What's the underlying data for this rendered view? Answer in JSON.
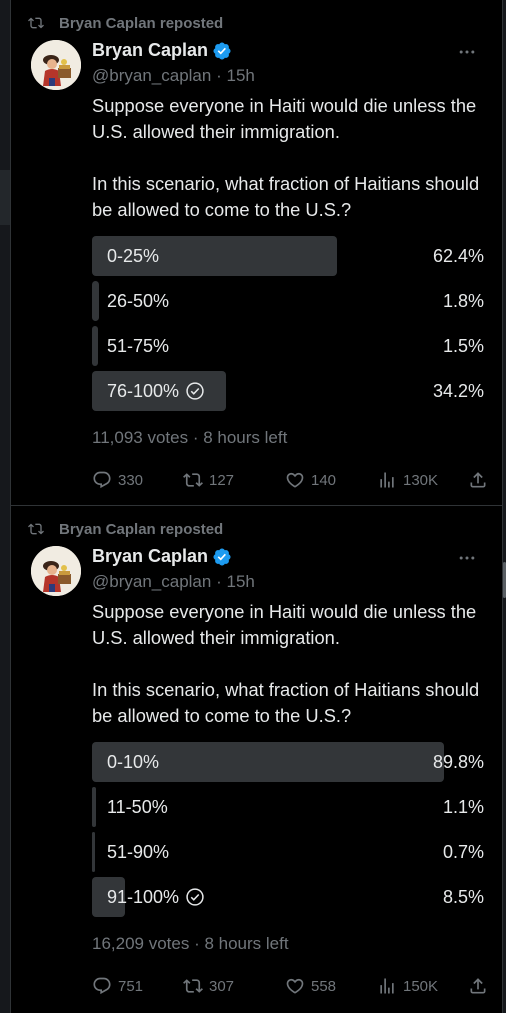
{
  "colors": {
    "background": "#000000",
    "text": "#e7e9ea",
    "muted": "#71767b",
    "verified": "#1d9bf0",
    "bar": "#333639"
  },
  "tweets": [
    {
      "repost_label": "Bryan Caplan reposted",
      "author": "Bryan Caplan",
      "handle": "@bryan_caplan",
      "dot": "·",
      "time": "15h",
      "text_1": "Suppose everyone in Haiti would die unless the U.S. allowed their immigration.",
      "text_2": "In this scenario, what fraction of Haitians should be allowed to come to the U.S.?",
      "poll": [
        {
          "label": "0-25%",
          "percent": "62.4%",
          "value": 62.4,
          "selected": false
        },
        {
          "label": "26-50%",
          "percent": "1.8%",
          "value": 1.8,
          "selected": false
        },
        {
          "label": "51-75%",
          "percent": "1.5%",
          "value": 1.5,
          "selected": false
        },
        {
          "label": "76-100%",
          "percent": "34.2%",
          "value": 34.2,
          "selected": true
        }
      ],
      "poll_meta": "11,093 votes · 8 hours left",
      "replies": "330",
      "reposts": "127",
      "likes": "140",
      "views": "130K"
    },
    {
      "repost_label": "Bryan Caplan reposted",
      "author": "Bryan Caplan",
      "handle": "@bryan_caplan",
      "dot": "·",
      "time": "15h",
      "text_1": "Suppose everyone in Haiti would die unless the U.S. allowed their immigration.",
      "text_2": "In this scenario, what fraction of Haitians should be allowed to come to the U.S.?",
      "poll": [
        {
          "label": "0-10%",
          "percent": "89.8%",
          "value": 89.8,
          "selected": false
        },
        {
          "label": "11-50%",
          "percent": "1.1%",
          "value": 1.1,
          "selected": false
        },
        {
          "label": "51-90%",
          "percent": "0.7%",
          "value": 0.7,
          "selected": false
        },
        {
          "label": "91-100%",
          "percent": "8.5%",
          "value": 8.5,
          "selected": true
        }
      ],
      "poll_meta": "16,209 votes · 8 hours left",
      "replies": "751",
      "reposts": "307",
      "likes": "558",
      "views": "150K"
    }
  ]
}
